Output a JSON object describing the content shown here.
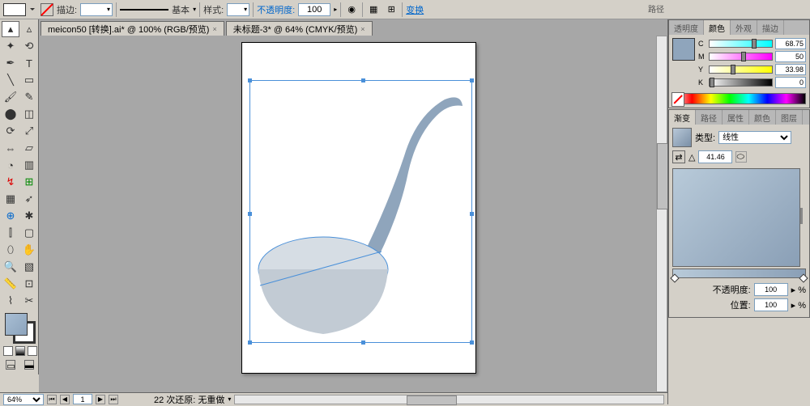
{
  "toolbar": {
    "stroke_label": "描边:",
    "stroke_weight": "",
    "basic_label": "基本",
    "style_label": "样式:",
    "opacity_label": "不透明度:",
    "opacity_value": "100",
    "transform_link": "变换",
    "path_label": "路径"
  },
  "tabs": [
    {
      "label": "meicon50 [转换].ai* @ 100% (RGB/预览)"
    },
    {
      "label": "未标题-3* @ 64% (CMYK/预览)"
    }
  ],
  "color_panel": {
    "tabs": [
      "透明度",
      "颜色",
      "外观",
      "描边"
    ],
    "active_tab": 1,
    "c_value": "68.75",
    "m_value": "50",
    "y_value": "33.98",
    "k_value": "0"
  },
  "gradient_panel": {
    "tabs": [
      "渐变",
      "路径",
      "属性",
      "颜色",
      "图层"
    ],
    "active_tab": 0,
    "type_label": "类型:",
    "type_value": "线性",
    "angle_value": "41.46",
    "opacity_label": "不透明度:",
    "opacity_value": "100",
    "position_label": "位置:",
    "position_value": "100"
  },
  "status": {
    "zoom": "64%",
    "page": "1",
    "undo_text": "22 次还原: 无重做"
  }
}
